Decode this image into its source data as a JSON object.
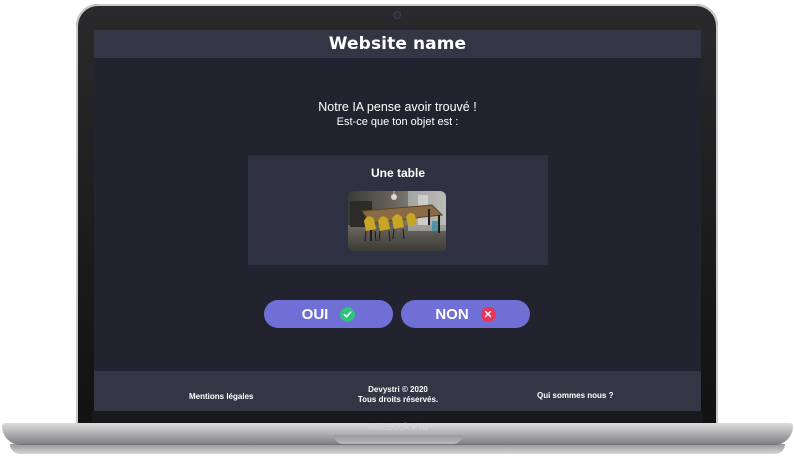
{
  "site": {
    "title": "Website name"
  },
  "intro": {
    "line1": "Notre IA pense avoir trouvé !",
    "line2": "Est-ce que ton objet est :"
  },
  "guess": {
    "label": "Une table",
    "image_alt": "dining-table-photo"
  },
  "buttons": {
    "yes_label": "OUI",
    "no_label": "NON",
    "yes_icon": "check-circle-icon",
    "no_icon": "x-circle-icon",
    "yes_icon_color": "#2fc27d",
    "no_icon_color": "#e8365a",
    "button_color": "#6f6fd6"
  },
  "footer": {
    "legal": "Mentions légales",
    "copyright_line1": "Devystri © 2020",
    "copyright_line2": "Tous droits réservés.",
    "about": "Qui sommes nous ?"
  },
  "device": {
    "brand": "MacBook Pro"
  },
  "colors": {
    "background": "#23232f",
    "header_footer": "#343646",
    "card": "#2e3142"
  }
}
